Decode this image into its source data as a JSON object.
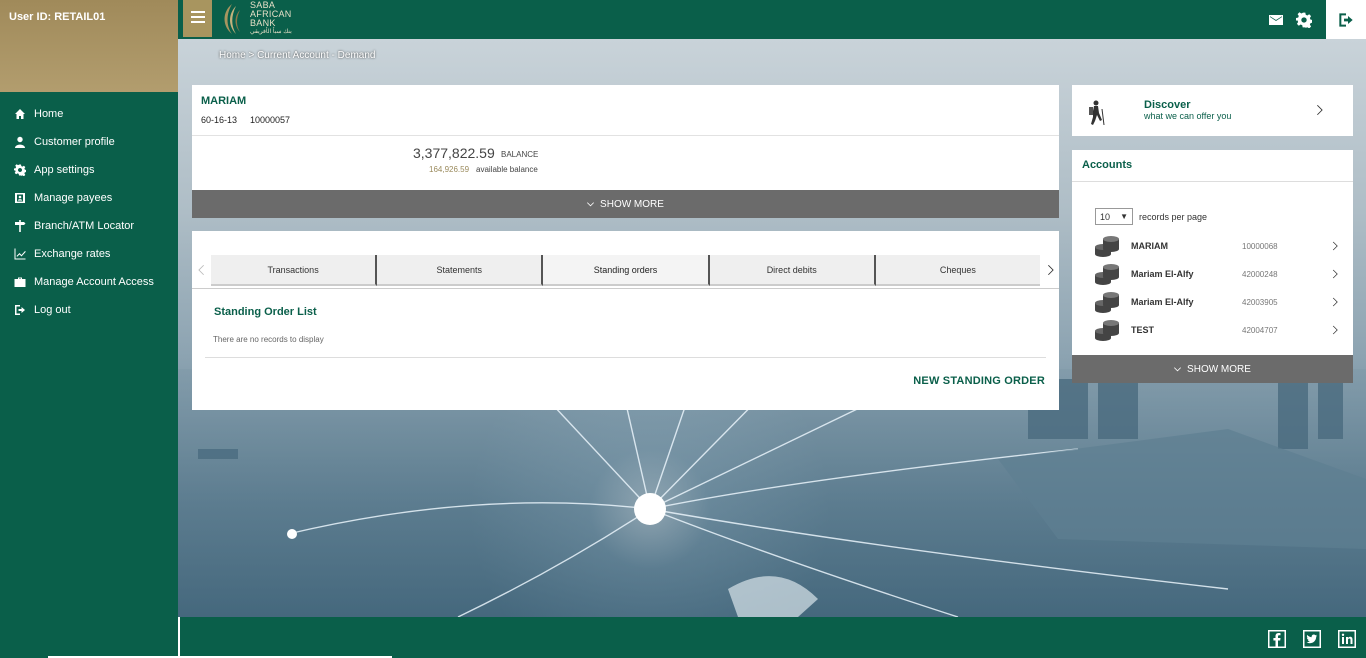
{
  "user": {
    "id_label": "User ID: RETAIL01"
  },
  "sidebar": {
    "items": [
      {
        "label": "Home",
        "icon": "home-icon"
      },
      {
        "label": "Customer profile",
        "icon": "user-icon"
      },
      {
        "label": "App settings",
        "icon": "gear-icon"
      },
      {
        "label": "Manage payees",
        "icon": "contact-card-icon"
      },
      {
        "label": "Branch/ATM Locator",
        "icon": "signpost-icon"
      },
      {
        "label": "Exchange rates",
        "icon": "chart-line-icon"
      },
      {
        "label": "Manage Account Access",
        "icon": "briefcase-icon"
      },
      {
        "label": "Log out",
        "icon": "logout-icon"
      }
    ]
  },
  "brand": {
    "line1": "SABA",
    "line2": "AFRICAN",
    "line3": "BANK",
    "arabic": "بنك سبأ الأفريقي"
  },
  "breadcrumb": {
    "text": "Home > Current Account - Demand"
  },
  "account": {
    "name": "MARIAM",
    "sort_code": "60-16-13",
    "number": "10000057",
    "balance": "3,377,822.59",
    "balance_label": "BALANCE",
    "available": "164,926.59",
    "available_label": "available balance",
    "show_more": "SHOW MORE"
  },
  "tabs": [
    {
      "label": "Transactions"
    },
    {
      "label": "Statements"
    },
    {
      "label": "Standing orders",
      "active": true
    },
    {
      "label": "Direct debits"
    },
    {
      "label": "Cheques"
    }
  ],
  "standing_orders": {
    "title": "Standing Order List",
    "empty": "There are no records to display",
    "new_button": "NEW STANDING ORDER"
  },
  "discover": {
    "title": "Discover",
    "subtitle": "what we can offer you"
  },
  "accounts_panel": {
    "title": "Accounts",
    "per_page_value": "10",
    "per_page_label": "records per page",
    "rows": [
      {
        "name": "MARIAM",
        "number": "10000068"
      },
      {
        "name": "Mariam El-Alfy",
        "number": "42000248"
      },
      {
        "name": "Mariam El-Alfy",
        "number": "42003905"
      },
      {
        "name": "TEST",
        "number": "42004707"
      }
    ],
    "show_more": "SHOW MORE"
  },
  "colors": {
    "brand_green": "#0a5f4a",
    "brand_gold": "#a8955f",
    "show_more_gray": "#6b6b6b"
  }
}
